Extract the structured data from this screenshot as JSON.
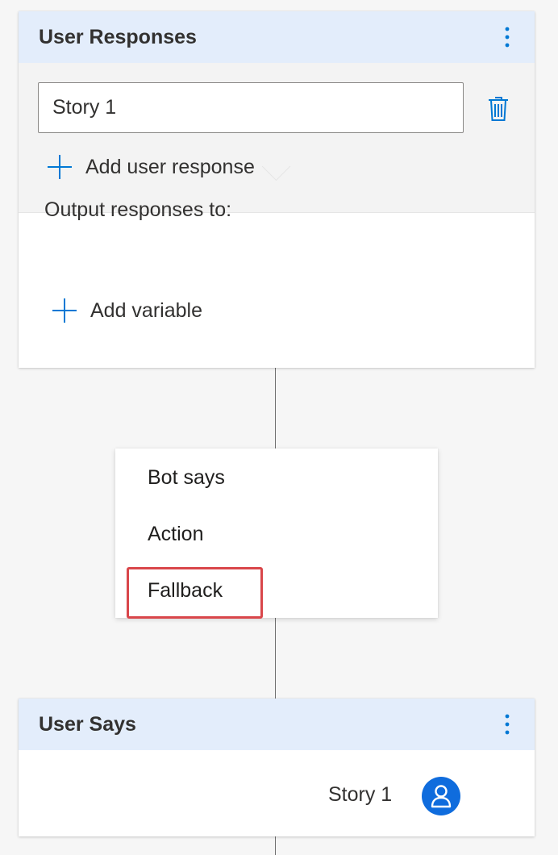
{
  "user_responses": {
    "title": "User Responses",
    "response_value": "Story 1",
    "add_response_label": "Add user response",
    "output_label": "Output responses to:",
    "add_variable_label": "Add variable"
  },
  "menu": {
    "items": [
      "Bot says",
      "Action",
      "Fallback"
    ],
    "highlighted_item": "Fallback"
  },
  "user_says": {
    "title": "User Says",
    "text": "Story 1"
  },
  "icons": {
    "more": "more-vertical-icon",
    "delete": "trash-icon",
    "add": "plus-icon",
    "avatar": "person-icon"
  },
  "colors": {
    "header_bg": "#e3edfb",
    "accent": "#0078d4",
    "avatar_bg": "#0f6cdd",
    "highlight": "#d9464a"
  }
}
